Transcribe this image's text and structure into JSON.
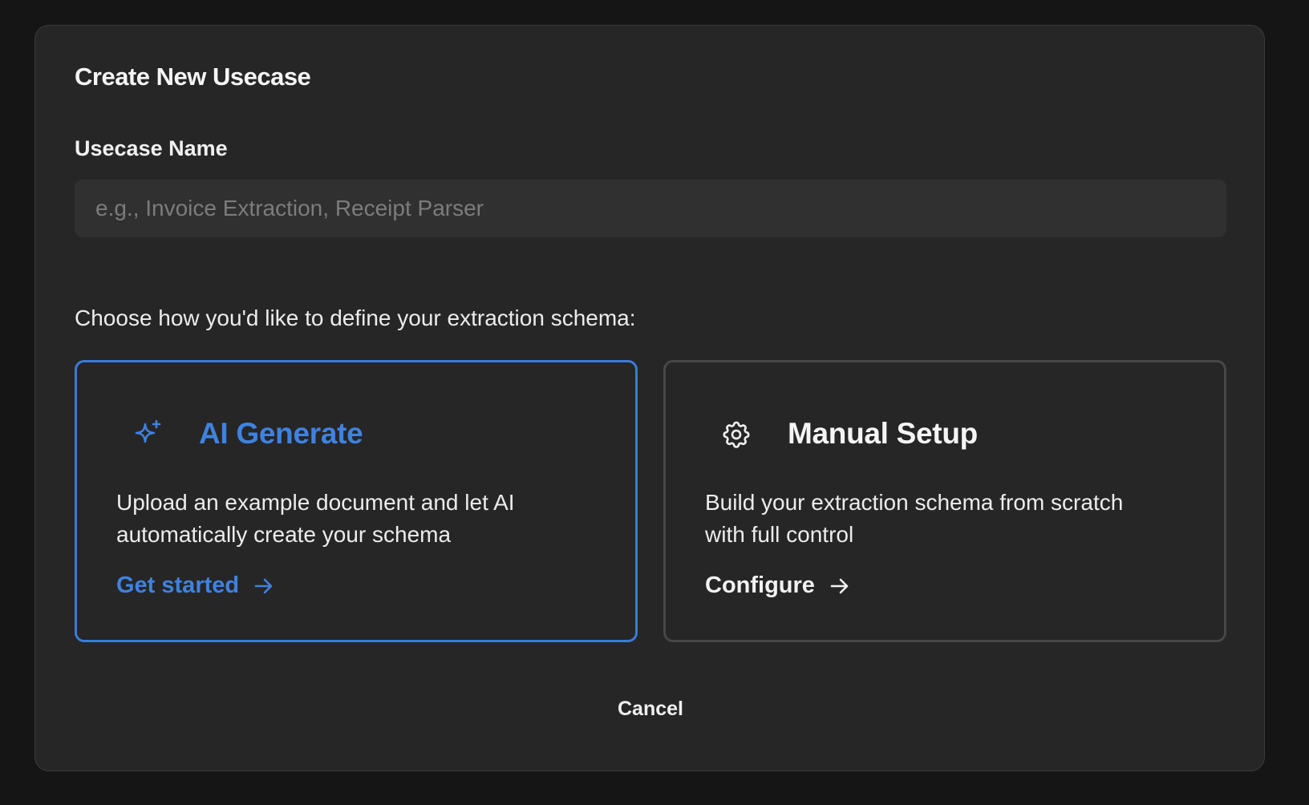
{
  "dialog": {
    "title": "Create New Usecase",
    "name_label": "Usecase Name",
    "name_input": {
      "value": "",
      "placeholder": "e.g., Invoice Extraction, Receipt Parser"
    },
    "choose_prompt": "Choose how you'd like to define your extraction schema:",
    "options": [
      {
        "icon": "sparkles-icon",
        "title": "AI Generate",
        "description": "Upload an example document and let AI automatically create your schema",
        "link": "Get started",
        "selected": true
      },
      {
        "icon": "gear-icon",
        "title": "Manual Setup",
        "description": "Build your extraction schema from scratch with full control",
        "link": "Configure",
        "selected": false
      }
    ],
    "cancel_label": "Cancel"
  },
  "colors": {
    "accent": "#3a7bdc",
    "background": "#151515",
    "dialog_background": "#262626",
    "input_background": "#303030"
  }
}
